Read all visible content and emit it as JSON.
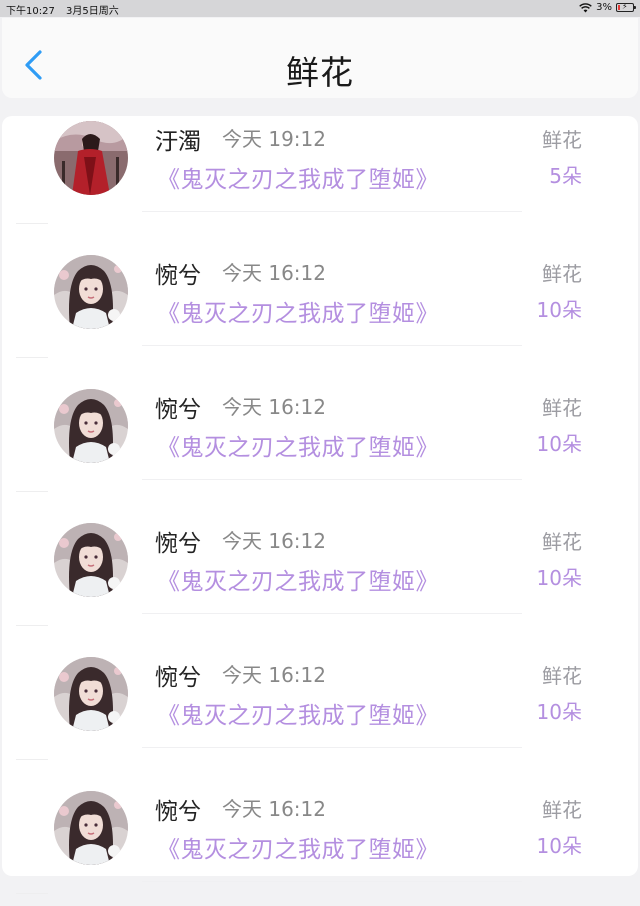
{
  "status_bar": {
    "time": "下午10:27",
    "date": "3月5日周六",
    "battery": "3%"
  },
  "nav": {
    "title": "鲜花"
  },
  "colors": {
    "accent": "#b48fe0",
    "back": "#2f9cf5"
  },
  "records": [
    {
      "user": "汙濁",
      "time": "今天 19:12",
      "book": "《鬼灭之刃之我成了堕姬》",
      "gift": "鲜花",
      "count": "5朵",
      "avatar": "red-robed-figure"
    },
    {
      "user": "惋兮",
      "time": "今天 16:12",
      "book": "《鬼灭之刃之我成了堕姬》",
      "gift": "鲜花",
      "count": "10朵",
      "avatar": "dark-haired-girl"
    },
    {
      "user": "惋兮",
      "time": "今天 16:12",
      "book": "《鬼灭之刃之我成了堕姬》",
      "gift": "鲜花",
      "count": "10朵",
      "avatar": "dark-haired-girl"
    },
    {
      "user": "惋兮",
      "time": "今天 16:12",
      "book": "《鬼灭之刃之我成了堕姬》",
      "gift": "鲜花",
      "count": "10朵",
      "avatar": "dark-haired-girl"
    },
    {
      "user": "惋兮",
      "time": "今天 16:12",
      "book": "《鬼灭之刃之我成了堕姬》",
      "gift": "鲜花",
      "count": "10朵",
      "avatar": "dark-haired-girl"
    },
    {
      "user": "惋兮",
      "time": "今天 16:12",
      "book": "《鬼灭之刃之我成了堕姬》",
      "gift": "鲜花",
      "count": "10朵",
      "avatar": "dark-haired-girl"
    }
  ]
}
